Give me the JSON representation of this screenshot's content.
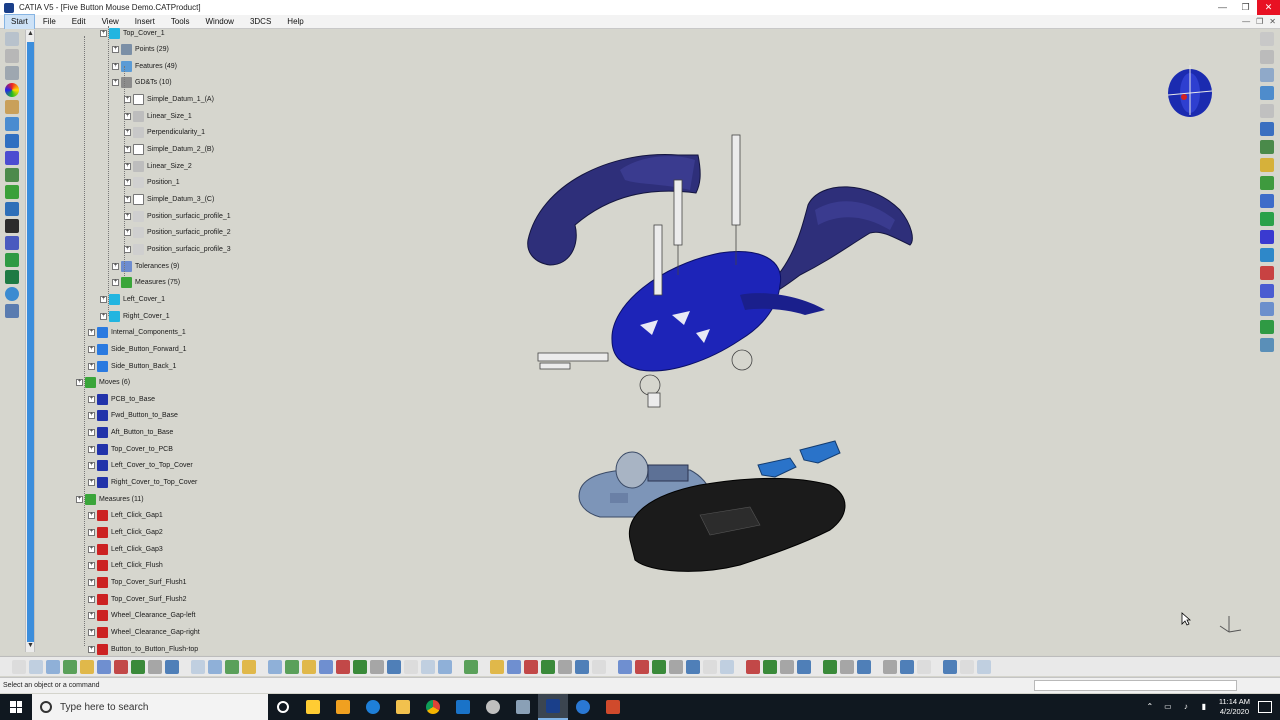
{
  "titlebar": {
    "title": "CATIA V5 - [Five Button Mouse Demo.CATProduct]",
    "minimize": "—",
    "restore": "❐",
    "close": "✕"
  },
  "menubar": {
    "items": [
      "Start",
      "File",
      "Edit",
      "View",
      "Insert",
      "Tools",
      "Window",
      "3DCS",
      "Help"
    ],
    "doc_controls": [
      "—",
      "❐",
      "✕"
    ]
  },
  "tree": {
    "rows": [
      {
        "label": "Top_Cover_1",
        "indent": 4,
        "icon": "part-icon"
      },
      {
        "label": "Points (29)",
        "indent": 5,
        "icon": "points-set-icon"
      },
      {
        "label": "Features (49)",
        "indent": 5,
        "icon": "features-set-icon"
      },
      {
        "label": "GD&Ts (10)",
        "indent": 5,
        "icon": "gdt-set-icon"
      },
      {
        "label": "Simple_Datum_1_(A)",
        "indent": 6,
        "icon": "datum-icon"
      },
      {
        "label": "Linear_Size_1",
        "indent": 6,
        "icon": "size-icon"
      },
      {
        "label": "Perpendicularity_1",
        "indent": 6,
        "icon": "tolerance-icon"
      },
      {
        "label": "Simple_Datum_2_(B)",
        "indent": 6,
        "icon": "datum-icon"
      },
      {
        "label": "Linear_Size_2",
        "indent": 6,
        "icon": "size-icon"
      },
      {
        "label": "Position_1",
        "indent": 6,
        "icon": "position-icon"
      },
      {
        "label": "Simple_Datum_3_(C)",
        "indent": 6,
        "icon": "datum-icon"
      },
      {
        "label": "Position_surfacic_profile_1",
        "indent": 6,
        "icon": "profile-icon"
      },
      {
        "label": "Position_surfacic_profile_2",
        "indent": 6,
        "icon": "profile-icon"
      },
      {
        "label": "Position_surfacic_profile_3",
        "indent": 6,
        "icon": "profile-icon"
      },
      {
        "label": "Tolerances (9)",
        "indent": 5,
        "icon": "tolerances-set-icon"
      },
      {
        "label": "Measures (75)",
        "indent": 5,
        "icon": "measures-set-icon"
      },
      {
        "label": "Left_Cover_1",
        "indent": 4,
        "icon": "part-icon"
      },
      {
        "label": "Right_Cover_1",
        "indent": 4,
        "icon": "part-icon"
      },
      {
        "label": "Internal_Components_1",
        "indent": 3,
        "icon": "component-icon"
      },
      {
        "label": "Side_Button_Forward_1",
        "indent": 3,
        "icon": "component-icon"
      },
      {
        "label": "Side_Button_Back_1",
        "indent": 3,
        "icon": "component-icon"
      },
      {
        "label": "Moves (6)",
        "indent": 2,
        "icon": "moves-set-icon"
      },
      {
        "label": "PCB_to_Base",
        "indent": 3,
        "icon": "move-icon"
      },
      {
        "label": "Fwd_Button_to_Base",
        "indent": 3,
        "icon": "move-icon"
      },
      {
        "label": "Aft_Button_to_Base",
        "indent": 3,
        "icon": "move-icon"
      },
      {
        "label": "Top_Cover_to_PCB",
        "indent": 3,
        "icon": "move-icon"
      },
      {
        "label": "Left_Cover_to_Top_Cover",
        "indent": 3,
        "icon": "move-icon"
      },
      {
        "label": "Right_Cover_to_Top_Cover",
        "indent": 3,
        "icon": "move-icon"
      },
      {
        "label": "Measures (11)",
        "indent": 2,
        "icon": "measures-set-icon"
      },
      {
        "label": "Left_Click_Gap1",
        "indent": 3,
        "icon": "measure-icon"
      },
      {
        "label": "Left_Click_Gap2",
        "indent": 3,
        "icon": "measure-icon"
      },
      {
        "label": "Left_Click_Gap3",
        "indent": 3,
        "icon": "measure-icon"
      },
      {
        "label": "Left_Click_Flush",
        "indent": 3,
        "icon": "measure-icon"
      },
      {
        "label": "Top_Cover_Surf_Flush1",
        "indent": 3,
        "icon": "measure-icon"
      },
      {
        "label": "Top_Cover_Surf_Flush2",
        "indent": 3,
        "icon": "measure-icon"
      },
      {
        "label": "Wheel_Clearance_Gap-left",
        "indent": 3,
        "icon": "measure-icon"
      },
      {
        "label": "Wheel_Clearance_Gap-right",
        "indent": 3,
        "icon": "measure-icon"
      },
      {
        "label": "Button_to_Button_Flush-top",
        "indent": 3,
        "icon": "measure-icon"
      }
    ]
  },
  "statusbar": {
    "message": "Select an object or a command"
  },
  "taskbar": {
    "search_placeholder": "Type here to search",
    "time": "11:14 AM",
    "date": "4/2/2020"
  },
  "colors": {
    "canvas_bg": "#d6d6ce",
    "cover_navy": "#2e2f7a",
    "top_cover_blue": "#1d24b8",
    "base_black": "#1b1b1b",
    "pcb_steel": "#7d95b8",
    "side_button_blue": "#2a73c9",
    "tree_scroll_thumb": "#3c8edc"
  }
}
